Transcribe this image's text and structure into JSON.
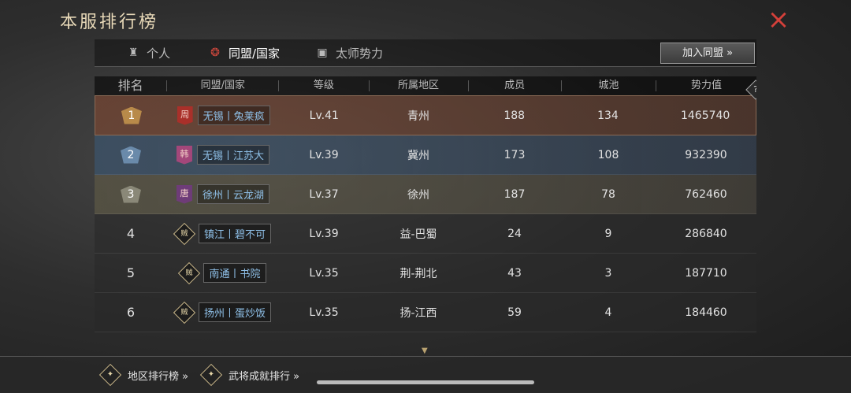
{
  "header": {
    "title": "本服排行榜",
    "close_icon": "×"
  },
  "tabs": [
    {
      "label": "个人",
      "icon": "person-icon"
    },
    {
      "label": "同盟/国家",
      "icon": "alliance-icon",
      "active": true
    },
    {
      "label": "太师势力",
      "icon": "faction-icon"
    }
  ],
  "join_button": "加入同盟 »",
  "table": {
    "columns": [
      "排名",
      "同盟/国家",
      "等级",
      "所属地区",
      "成员",
      "城池",
      "势力值"
    ],
    "help": "?",
    "rows": [
      {
        "rank": "1",
        "flag": "周",
        "alliance": "无锡丨兔莱疯",
        "level": "Lv.41",
        "region": "青州",
        "members": "188",
        "cities": "134",
        "power": "1465740"
      },
      {
        "rank": "2",
        "flag": "韩",
        "alliance": "无锡丨江苏大",
        "level": "Lv.39",
        "region": "冀州",
        "members": "173",
        "cities": "108",
        "power": "932390"
      },
      {
        "rank": "3",
        "flag": "唐",
        "alliance": "徐州丨云龙湖",
        "level": "Lv.37",
        "region": "徐州",
        "members": "187",
        "cities": "78",
        "power": "762460"
      },
      {
        "rank": "4",
        "flag": "贼",
        "alliance": "镇江丨碧不可",
        "level": "Lv.39",
        "region": "益-巴蜀",
        "members": "24",
        "cities": "9",
        "power": "286840"
      },
      {
        "rank": "5",
        "flag": "贼",
        "alliance": "南通丨书院",
        "level": "Lv.35",
        "region": "荆-荆北",
        "members": "43",
        "cities": "3",
        "power": "187710"
      },
      {
        "rank": "6",
        "flag": "贼",
        "alliance": "扬州丨蛋炒饭",
        "level": "Lv.35",
        "region": "扬-江西",
        "members": "59",
        "cities": "4",
        "power": "184460"
      }
    ]
  },
  "bottom": {
    "region_rank": "地区排行榜 »",
    "general_rank": "武将成就排行 »"
  }
}
